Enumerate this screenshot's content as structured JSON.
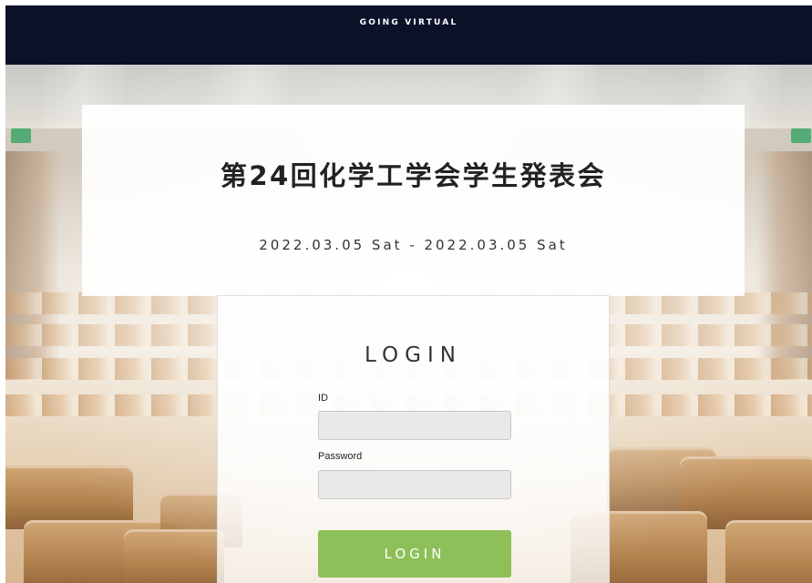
{
  "header": {
    "title": "GOING VIRTUAL"
  },
  "event": {
    "title": "第24回化学工学会学生発表会",
    "dates": "2022.03.05 Sat - 2022.03.05 Sat"
  },
  "login": {
    "heading": "LOGIN",
    "id_label": "ID",
    "id_value": "",
    "password_label": "Password",
    "password_value": "",
    "button_label": "LOGIN"
  },
  "colors": {
    "header_bg": "#0b1228",
    "button_green": "#8dc059",
    "input_bg": "#e9e9e9"
  }
}
